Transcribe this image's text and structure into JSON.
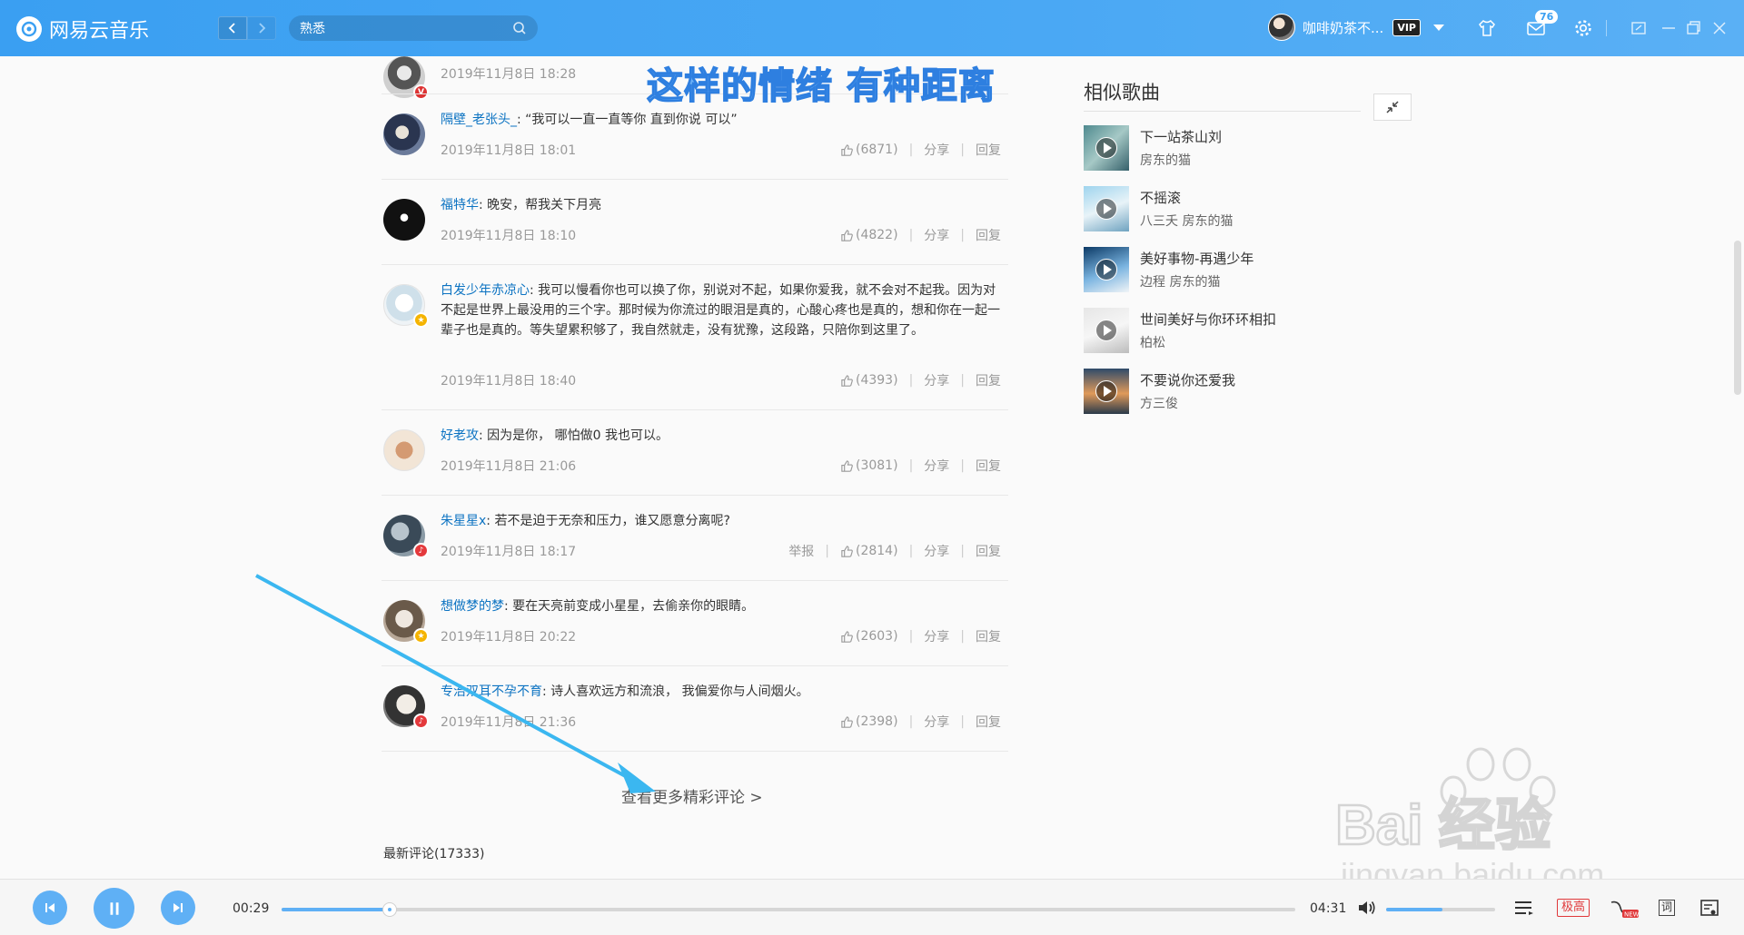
{
  "app": {
    "name": "网易云音乐"
  },
  "search": {
    "value": "熟悉"
  },
  "user": {
    "name": "咖啡奶茶不...",
    "vip_label": "VIP",
    "message_count": "76"
  },
  "lyric_overlay": "这样的情绪 有种距离",
  "comments": [
    {
      "user": "",
      "text": "",
      "time": "2019年11月8日 18:28",
      "likes": "",
      "avatar_badge": "V"
    },
    {
      "user": "隔壁_老张头_",
      "text": "“我可以一直一直等你 直到你说 可以”",
      "time": "2019年11月8日 18:01",
      "likes": "(6871)"
    },
    {
      "user": "福特华",
      "text": "晚安，帮我关下月亮",
      "time": "2019年11月8日 18:10",
      "likes": "(4822)"
    },
    {
      "user": "白发少年赤凉心",
      "text": "我可以慢看你也可以换了你，别说对不起，如果你爱我，就不会对不起我。因为对不起是世界上最没用的三个字。那时候为你流过的眼泪是真的，心酸心疼也是真的，想和你在一起一辈子也是真的。等失望累积够了，我自然就走，没有犹豫，这段路，只陪你到这里了。",
      "time": "2019年11月8日 18:40",
      "likes": "(4393)"
    },
    {
      "user": "好老攻",
      "text": "因为是你，  哪怕做0 我也可以。",
      "time": "2019年11月8日 21:06",
      "likes": "(3081)"
    },
    {
      "user": "朱星星x",
      "text": "若不是迫于无奈和压力，谁又愿意分离呢?",
      "time": "2019年11月8日 18:17",
      "likes": "(2814)",
      "report": "举报"
    },
    {
      "user": "想做梦的梦",
      "text": "要在天亮前变成小星星，去偷亲你的眼睛。",
      "time": "2019年11月8日 20:22",
      "likes": "(2603)"
    },
    {
      "user": "专治双耳不孕不育",
      "text": "诗人喜欢远方和流浪，  我偏爱你与人间烟火。",
      "time": "2019年11月8日 21:36",
      "likes": "(2398)"
    }
  ],
  "actions": {
    "share": "分享",
    "reply": "回复"
  },
  "more_comments": "查看更多精彩评论 >",
  "latest_comments": "最新评论(17333)",
  "similar": {
    "title": "相似歌曲",
    "songs": [
      {
        "name": "下一站茶山刘",
        "artist": "房东的猫"
      },
      {
        "name": "不摇滚",
        "artist": "八三夭 房东的猫"
      },
      {
        "name": "美好事物-再遇少年",
        "artist": "边程 房东的猫"
      },
      {
        "name": "世间美好与你环环相扣",
        "artist": "柏松"
      },
      {
        "name": "不要说你还爱我",
        "artist": "方三俊"
      }
    ]
  },
  "player": {
    "current_time": "00:29",
    "total_time": "04:31",
    "progress": 0.107,
    "volume": 0.52,
    "quality": "极高",
    "lyric_toggle": "词"
  },
  "watermark": {
    "brand": "Bai 经验",
    "url": "jingyan.baidu.com"
  },
  "colors": {
    "accent": "#3a9ff2",
    "link": "#0c73c2",
    "quality": "#e0383a"
  }
}
